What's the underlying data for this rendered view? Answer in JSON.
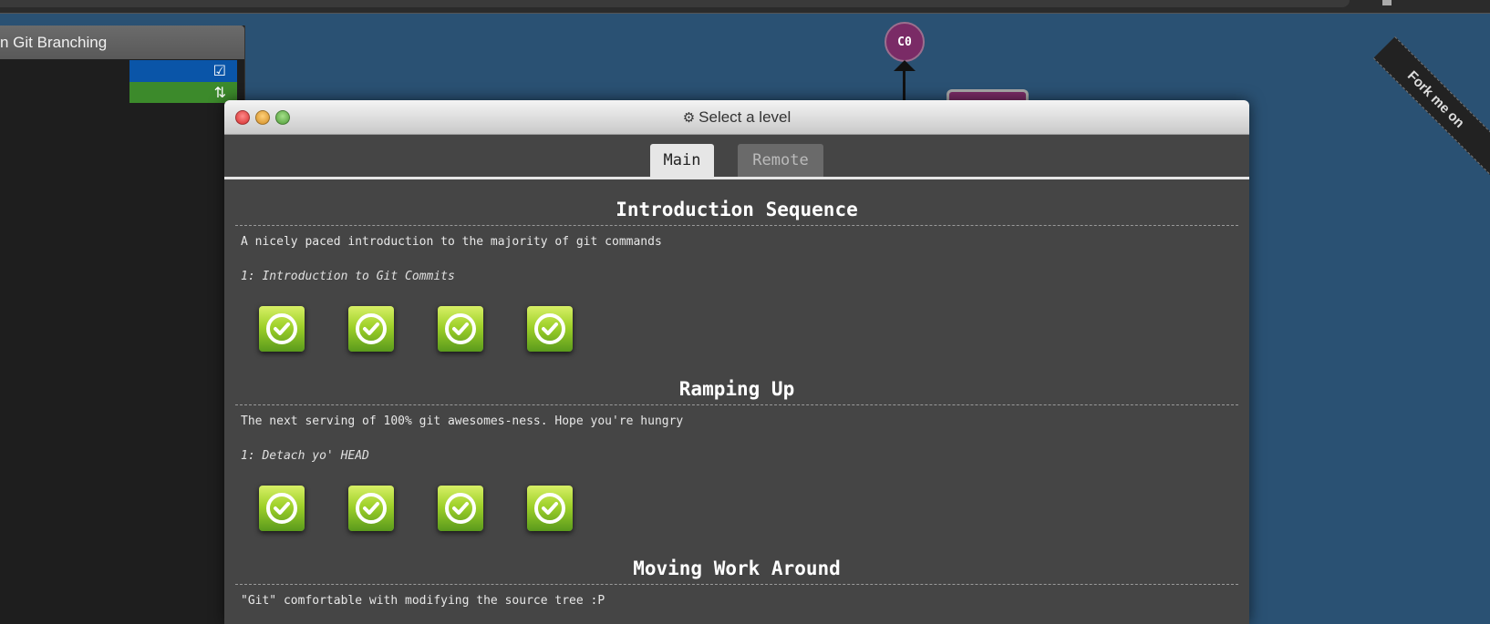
{
  "left_panel": {
    "header": "n Git Branching",
    "blue_icon": "checkbox-icon",
    "green_icon": "swap-icon"
  },
  "graph": {
    "node_label": "C0"
  },
  "ribbon": {
    "text": "Fork me on"
  },
  "modal": {
    "title": "Select a level",
    "title_icon": "gear-icon",
    "tabs": [
      {
        "label": "Main",
        "active": true
      },
      {
        "label": "Remote",
        "active": false
      }
    ],
    "sequences": [
      {
        "title": "Introduction Sequence",
        "description": "A nicely paced introduction to the majority of git commands",
        "level_name": "1: Introduction to Git Commits",
        "levels_completed": 4
      },
      {
        "title": "Ramping Up",
        "description": "The next serving of 100% git awesomes-ness. Hope you're hungry",
        "level_name": "1: Detach yo' HEAD",
        "levels_completed": 4
      },
      {
        "title": "Moving Work Around",
        "description": "\"Git\" comfortable with modifying the source tree :P"
      }
    ]
  },
  "colors": {
    "background": "#2a5173",
    "modal_bg": "#454545",
    "complete_green": "#9fd12a"
  }
}
